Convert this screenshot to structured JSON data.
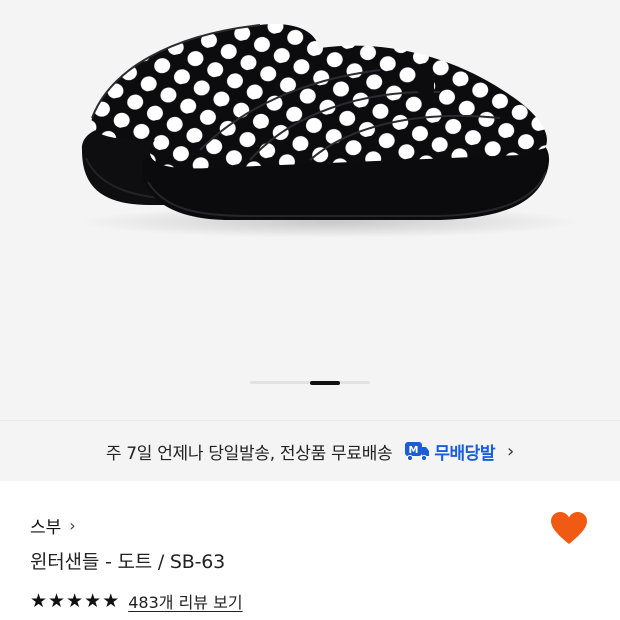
{
  "product_image": {
    "pager": {
      "total": 4,
      "active": 2
    }
  },
  "delivery_banner": {
    "text": "주 7일 언제나 당일발송, 전상품 무료배송",
    "badge_label": "무배당발",
    "chevron": "›"
  },
  "product": {
    "brand": "스부",
    "brand_chevron": "›",
    "name": "윈터샌들 - 도트 / SB-63",
    "rating_stars": 5,
    "review_link": "483개 리뷰 보기"
  },
  "colors": {
    "badge_blue": "#1a5dd8",
    "heart_orange": "#f05a12",
    "background": "#f4f4f4"
  },
  "icons": {
    "badge": "m-truck-icon",
    "wishlist": "heart-icon",
    "star": "star-icon"
  }
}
